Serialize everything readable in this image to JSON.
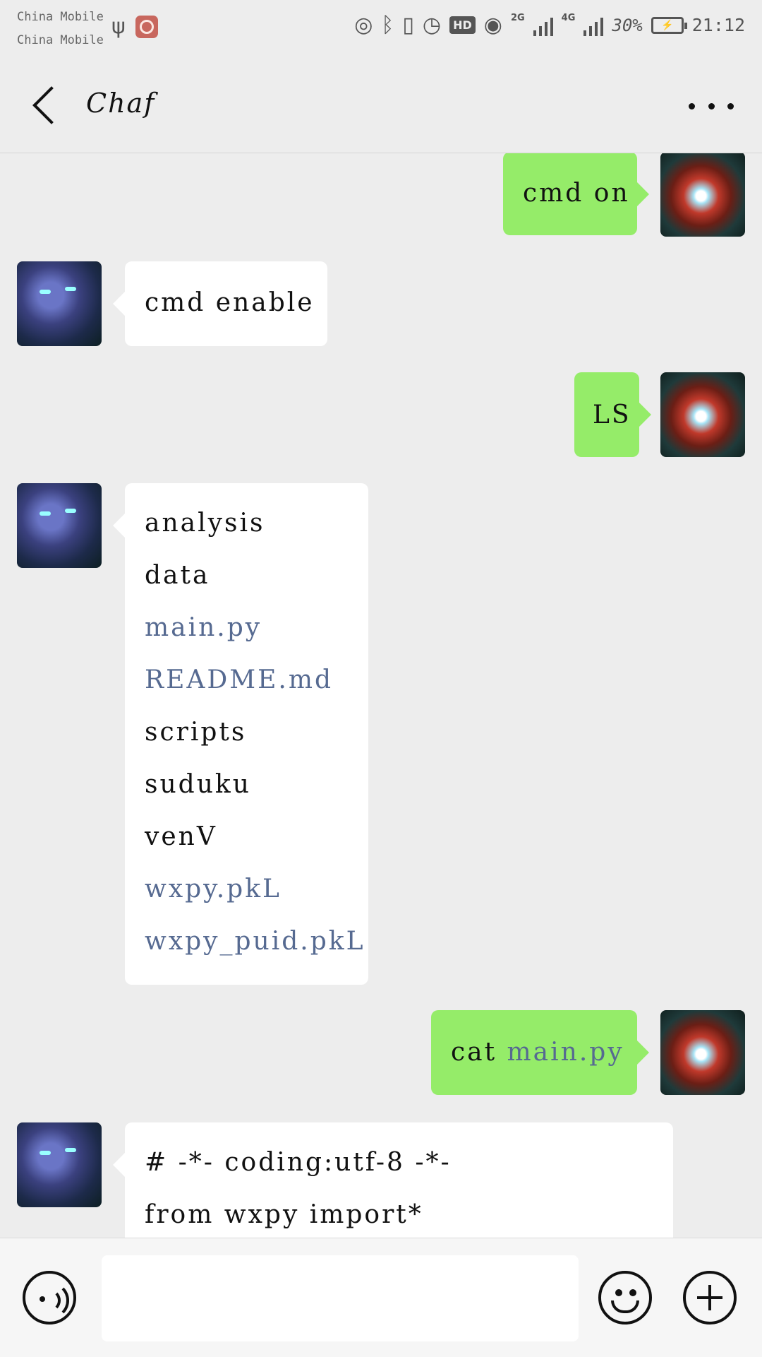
{
  "status_bar": {
    "carrier_1": "China Mobile",
    "carrier_2": "China Mobile",
    "network_1": "2G",
    "network_2": "4G",
    "battery_percent": "30%",
    "time": "21:12",
    "hd_badge": "HD",
    "icons": [
      "usb-icon",
      "app-icon",
      "hotspot-icon",
      "bluetooth-icon",
      "vibrate-icon",
      "alarm-icon",
      "hd-icon",
      "eye-icon",
      "signal-icon",
      "battery-icon"
    ]
  },
  "header": {
    "title": "Chaf"
  },
  "messages": [
    {
      "from": "me",
      "text": "cmd on"
    },
    {
      "from": "bot",
      "text": "cmd enable"
    },
    {
      "from": "me",
      "text": "LS"
    },
    {
      "from": "bot",
      "lines": [
        "analysis",
        "data",
        "main.py",
        "README.md",
        "scripts",
        "suduku",
        "venV",
        "wxpy.pkL",
        "wxpy_puid.pkL"
      ]
    },
    {
      "from": "me",
      "prefix": "cat",
      "link": "main.py"
    },
    {
      "from": "bot",
      "lines": [
        "# -*- coding:utf-8 -*-",
        "from wxpy import*"
      ]
    }
  ],
  "colors": {
    "background": "#ededed",
    "out_bubble": "#95ec69",
    "in_bubble": "#ffffff",
    "link": "#566a91"
  },
  "input": {
    "value": ""
  }
}
